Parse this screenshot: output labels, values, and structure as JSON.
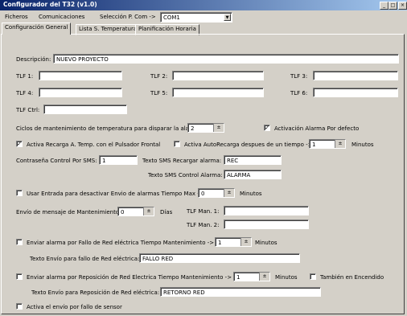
{
  "window": {
    "title": "Configurador del T32  (v1.0)"
  },
  "menu": {
    "items": [
      "Ficheros",
      "Comunicaciones",
      "Selección P. Com ->"
    ],
    "com_port": "COM1"
  },
  "tabs": [
    "Configuración General",
    "Lista S. Temperatura",
    "Planificación Horaria"
  ],
  "general": {
    "descripcion_label": "Descripción:",
    "descripcion_value": "NUEVO PROYECTO",
    "tlf_labels": [
      "TLF 1:",
      "TLF 2:",
      "TLF 3:",
      "TLF 4:",
      "TLF 5:",
      "TLF 6:",
      "TLF Ctrl:"
    ],
    "ciclos_label": "Ciclos de mantenimiento de temperatura para disparar la alarma:",
    "ciclos_value": "2",
    "activacion_label": "Activación Alarma Por defecto",
    "activacion_checked": true,
    "recarga_label": "Activa Recarga A. Temp. con el Pulsador Frontal",
    "recarga_checked": true,
    "autorecarga_label": "Activa AutoRecarga despues de un tiempo ->",
    "autorecarga_checked": false,
    "autorecarga_value": "1",
    "minutos": "Minutos",
    "contrasena_label": "Contraseña  Control Por SMS:",
    "contrasena_value": "1",
    "sms_recargar_label": "Texto SMS Recargar alarma:",
    "sms_recargar_value": "REC",
    "sms_control_label": "Texto SMS Control Alarma:",
    "sms_control_value": "ALARMA",
    "entrada_label": "Usar Entrada para desactivar Envio de alarmas  Tiempo Max ->",
    "entrada_checked": false,
    "entrada_value": "0",
    "mantenimiento_label": "Envío de mensaje de Mantenimiento:",
    "mantenimiento_value": "0",
    "dias": "Días",
    "tlf_man1_label": "TLF Man. 1:",
    "tlf_man2_label": "TLF Man. 2:",
    "fallo_red_label": "Enviar alarma por Fallo de Red eléctrica   Tiempo Mantenimiento ->",
    "fallo_red_checked": false,
    "fallo_red_value": "1",
    "fallo_texto_label": "Texto Envío para fallo de Red eléctrica:",
    "fallo_texto_value": "FALLO RED",
    "reposicion_label": "Enviar alarma por Reposición de Red Electrica    Tiempo Mantenimiento ->",
    "reposicion_checked": false,
    "reposicion_value": "1",
    "encendido_label": "También en Encendido",
    "encendido_checked": false,
    "reposicion_texto_label": "Texto Envío para Reposición de Red eléctrica:",
    "reposicion_texto_value": "RETORNO RED",
    "sensor_label": "Activa el envío por fallo de sensor",
    "sensor_checked": false
  }
}
